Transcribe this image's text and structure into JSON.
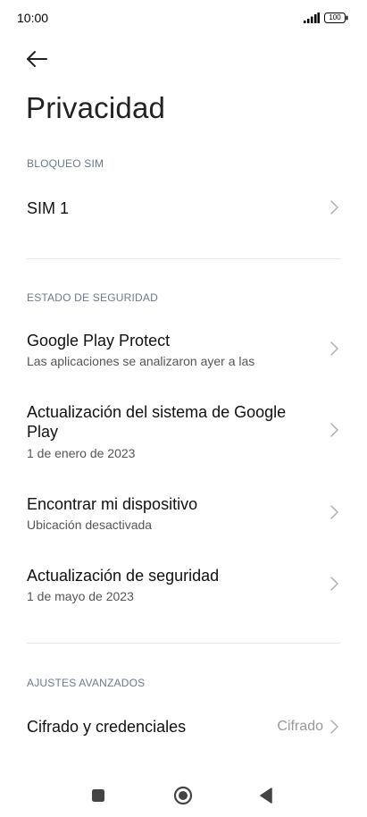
{
  "status_bar": {
    "time": "10:00",
    "battery": "100"
  },
  "header": {
    "title": "Privacidad"
  },
  "sections": {
    "sim_lock": {
      "header": "BLOQUEO SIM",
      "items": [
        {
          "title": "SIM 1"
        }
      ]
    },
    "security_status": {
      "header": "ESTADO DE SEGURIDAD",
      "items": [
        {
          "title": "Google Play Protect",
          "subtitle": "Las aplicaciones se analizaron ayer a las"
        },
        {
          "title": "Actualización del sistema de Google Play",
          "subtitle": "1 de enero de 2023"
        },
        {
          "title": "Encontrar mi dispositivo",
          "subtitle": "Ubicación desactivada"
        },
        {
          "title": "Actualización de seguridad",
          "subtitle": "1 de mayo de 2023"
        }
      ]
    },
    "advanced": {
      "header": "AJUSTES AVANZADOS",
      "items": [
        {
          "title": "Cifrado y credenciales",
          "value": "Cifrado"
        }
      ]
    }
  },
  "icons": {
    "back": "back-arrow-icon",
    "chevron": "chevron-right-icon",
    "nav_recents": "square-icon",
    "nav_home": "circle-icon",
    "nav_back": "triangle-back-icon"
  },
  "colors": {
    "section_header": "#6b7a8f",
    "chevron": "#b0b0b0",
    "value_text": "#999999"
  }
}
